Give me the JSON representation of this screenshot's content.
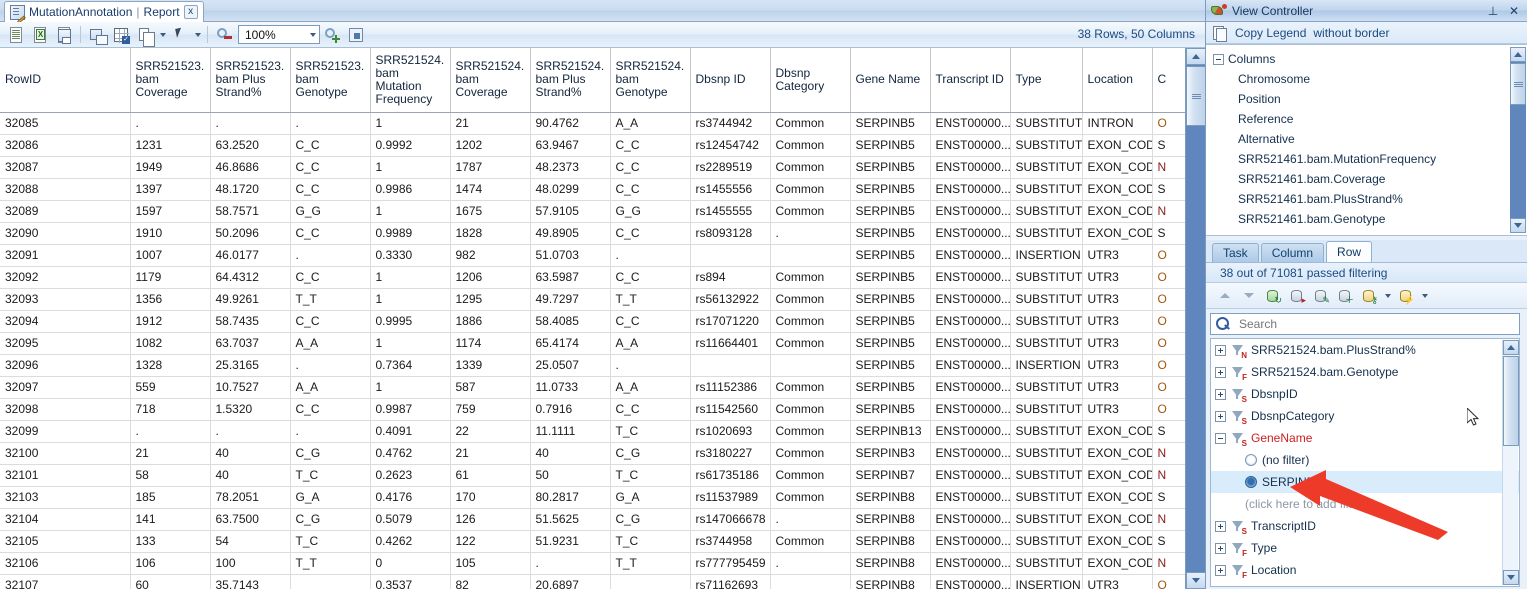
{
  "tab": {
    "title": "MutationAnnotation",
    "separator": "|",
    "subtitle": "Report",
    "close": "x",
    "icon": "report-document-icon"
  },
  "toolbar": {
    "buttons": [
      {
        "name": "export-text-icon",
        "label": ""
      },
      {
        "name": "export-excel-icon",
        "label": ""
      },
      {
        "name": "save-icon",
        "label": ""
      },
      {
        "name": "new-window-icon",
        "label": ""
      },
      {
        "name": "select-grid-icon",
        "label": ""
      },
      {
        "name": "copy-icon",
        "label": ""
      },
      {
        "name": "pointer-icon",
        "label": ""
      },
      {
        "name": "zoom-out-icon",
        "label": ""
      },
      {
        "name": "zoom-in-icon",
        "label": ""
      },
      {
        "name": "fit-to-window-icon",
        "label": ""
      }
    ],
    "zoom_value": "100%",
    "rows_columns": "38 Rows, 50 Columns"
  },
  "grid": {
    "columns": [
      "RowID",
      "SRR521523.bam Coverage",
      "SRR521523.bam Plus Strand%",
      "SRR521523.bam Genotype",
      "SRR521524.bam Mutation Frequency",
      "SRR521524.bam Coverage",
      "SRR521524.bam Plus Strand%",
      "SRR521524.bam Genotype",
      "Dbsnp ID",
      "Dbsnp Category",
      "Gene Name",
      "Transcript ID",
      "Type",
      "Location",
      "C"
    ],
    "rows": [
      [
        "32085",
        ".",
        ".",
        ".",
        "1",
        "21",
        "90.4762",
        "A_A",
        "rs3744942",
        "Common",
        "SERPINB5",
        "ENST00000...",
        "SUBSTITUT...",
        "INTRON",
        "O"
      ],
      [
        "32086",
        "1231",
        "63.2520",
        "C_C",
        "0.9992",
        "1202",
        "63.9467",
        "C_C",
        "rs12454742",
        "Common",
        "SERPINB5",
        "ENST00000...",
        "SUBSTITUT...",
        "EXON_COD...",
        "S"
      ],
      [
        "32087",
        "1949",
        "46.8686",
        "C_C",
        "1",
        "1787",
        "48.2373",
        "C_C",
        "rs2289519",
        "Common",
        "SERPINB5",
        "ENST00000...",
        "SUBSTITUT...",
        "EXON_COD...",
        "N"
      ],
      [
        "32088",
        "1397",
        "48.1720",
        "C_C",
        "0.9986",
        "1474",
        "48.0299",
        "C_C",
        "rs1455556",
        "Common",
        "SERPINB5",
        "ENST00000...",
        "SUBSTITUT...",
        "EXON_COD...",
        "S"
      ],
      [
        "32089",
        "1597",
        "58.7571",
        "G_G",
        "1",
        "1675",
        "57.9105",
        "G_G",
        "rs1455555",
        "Common",
        "SERPINB5",
        "ENST00000...",
        "SUBSTITUT...",
        "EXON_COD...",
        "N"
      ],
      [
        "32090",
        "1910",
        "50.2096",
        "C_C",
        "0.9989",
        "1828",
        "49.8905",
        "C_C",
        "rs8093128",
        ".",
        "SERPINB5",
        "ENST00000...",
        "SUBSTITUT...",
        "EXON_COD...",
        "S"
      ],
      [
        "32091",
        "1007",
        "46.0177",
        ".",
        "0.3330",
        "982",
        "51.0703",
        ".",
        "",
        "",
        "SERPINB5",
        "ENST00000...",
        "INSERTION",
        "UTR3",
        "O"
      ],
      [
        "32092",
        "1179",
        "64.4312",
        "C_C",
        "1",
        "1206",
        "63.5987",
        "C_C",
        "rs894",
        "Common",
        "SERPINB5",
        "ENST00000...",
        "SUBSTITUT...",
        "UTR3",
        "O"
      ],
      [
        "32093",
        "1356",
        "49.9261",
        "T_T",
        "1",
        "1295",
        "49.7297",
        "T_T",
        "rs56132922",
        "Common",
        "SERPINB5",
        "ENST00000...",
        "SUBSTITUT...",
        "UTR3",
        "O"
      ],
      [
        "32094",
        "1912",
        "58.7435",
        "C_C",
        "0.9995",
        "1886",
        "58.4085",
        "C_C",
        "rs17071220",
        "Common",
        "SERPINB5",
        "ENST00000...",
        "SUBSTITUT...",
        "UTR3",
        "O"
      ],
      [
        "32095",
        "1082",
        "63.7037",
        "A_A",
        "1",
        "1174",
        "65.4174",
        "A_A",
        "rs11664401",
        "Common",
        "SERPINB5",
        "ENST00000...",
        "SUBSTITUT...",
        "UTR3",
        "O"
      ],
      [
        "32096",
        "1328",
        "25.3165",
        ".",
        "0.7364",
        "1339",
        "25.0507",
        ".",
        "",
        "",
        "SERPINB5",
        "ENST00000...",
        "INSERTION",
        "UTR3",
        "O"
      ],
      [
        "32097",
        "559",
        "10.7527",
        "A_A",
        "1",
        "587",
        "11.0733",
        "A_A",
        "rs11152386",
        "Common",
        "SERPINB5",
        "ENST00000...",
        "SUBSTITUT...",
        "UTR3",
        "O"
      ],
      [
        "32098",
        "718",
        "1.5320",
        "C_C",
        "0.9987",
        "759",
        "0.7916",
        "C_C",
        "rs11542560",
        "Common",
        "SERPINB5",
        "ENST00000...",
        "SUBSTITUT...",
        "UTR3",
        "O"
      ],
      [
        "32099",
        ".",
        ".",
        ".",
        "0.4091",
        "22",
        "11.1111",
        "T_C",
        "rs1020693",
        "Common",
        "SERPINB13",
        "ENST00000...",
        "SUBSTITUT...",
        "EXON_COD...",
        "S"
      ],
      [
        "32100",
        "21",
        "40",
        "C_G",
        "0.4762",
        "21",
        "40",
        "C_G",
        "rs3180227",
        "Common",
        "SERPINB3",
        "ENST00000...",
        "SUBSTITUT...",
        "EXON_COD...",
        "N"
      ],
      [
        "32101",
        "58",
        "40",
        "T_C",
        "0.2623",
        "61",
        "50",
        "T_C",
        "rs61735186",
        "Common",
        "SERPINB7",
        "ENST00000...",
        "SUBSTITUT...",
        "EXON_COD...",
        "N"
      ],
      [
        "32103",
        "185",
        "78.2051",
        "G_A",
        "0.4176",
        "170",
        "80.2817",
        "G_A",
        "rs11537989",
        "Common",
        "SERPINB8",
        "ENST00000...",
        "SUBSTITUT...",
        "EXON_COD...",
        "S"
      ],
      [
        "32104",
        "141",
        "63.7500",
        "C_G",
        "0.5079",
        "126",
        "51.5625",
        "C_G",
        "rs147066678",
        ".",
        "SERPINB8",
        "ENST00000...",
        "SUBSTITUT...",
        "EXON_COD...",
        "N"
      ],
      [
        "32105",
        "133",
        "54",
        "T_C",
        "0.4262",
        "122",
        "51.9231",
        "T_C",
        "rs3744958",
        "Common",
        "SERPINB8",
        "ENST00000...",
        "SUBSTITUT...",
        "EXON_COD...",
        "S"
      ],
      [
        "32106",
        "106",
        "100",
        "T_T",
        "0",
        "105",
        ".",
        "T_T",
        "rs777795459",
        ".",
        "SERPINB8",
        "ENST00000...",
        "SUBSTITUT...",
        "EXON_COD...",
        "N"
      ],
      [
        "32107",
        "60",
        "35.7143",
        "",
        "0.3537",
        "82",
        "20.6897",
        "",
        "rs71162693",
        "",
        "SERPINB8",
        "ENST00000...",
        "INSERTION",
        "UTR3",
        "O"
      ]
    ]
  },
  "view_controller": {
    "title": "View Controller",
    "title_icon": "view-controller-icon",
    "pin_glyph": "⊥",
    "close_glyph": "✕",
    "legend": {
      "icon": "copy-legend-icon",
      "label": "Copy Legend",
      "suffix": "without border"
    },
    "columns_tree": {
      "root": "Columns",
      "items": [
        "Chromosome",
        "Position",
        "Reference",
        "Alternative",
        "SRR521461.bam.MutationFrequency",
        "SRR521461.bam.Coverage",
        "SRR521461.bam.PlusStrand%",
        "SRR521461.bam.Genotype"
      ]
    },
    "tabs": [
      {
        "label": "Task",
        "active": false
      },
      {
        "label": "Column",
        "active": false
      },
      {
        "label": "Row",
        "active": true
      }
    ],
    "status": "38 out of 71081 passed filtering",
    "toolbar2": [
      {
        "name": "move-up-icon"
      },
      {
        "name": "move-down-icon"
      },
      {
        "name": "refresh-database-icon"
      },
      {
        "name": "import-database-icon"
      },
      {
        "name": "edit-database-icon"
      },
      {
        "name": "add-database-icon"
      },
      {
        "name": "key-database-icon"
      },
      {
        "name": "key-database-dropdown-icon"
      },
      {
        "name": "lightning-database-icon"
      },
      {
        "name": "lightning-database-dropdown-icon"
      }
    ],
    "search": {
      "icon": "search-icon",
      "placeholder": "Search",
      "value": ""
    },
    "filter_list": [
      {
        "label": "SRR521524.bam.PlusStrand%",
        "tag": "N",
        "expander": "plus",
        "level": 0,
        "highlight": false
      },
      {
        "label": "SRR521524.bam.Genotype",
        "tag": "F",
        "expander": "plus",
        "level": 0,
        "highlight": false
      },
      {
        "label": "DbsnpID",
        "tag": "S",
        "expander": "plus",
        "level": 0,
        "highlight": false
      },
      {
        "label": "DbsnpCategory",
        "tag": "S",
        "expander": "plus",
        "level": 0,
        "highlight": false
      },
      {
        "label": "GeneName",
        "tag": "S",
        "expander": "minus",
        "level": 0,
        "highlight": true
      },
      {
        "label": "(no filter)",
        "tag": "",
        "expander": "none",
        "level": 1,
        "highlight": false,
        "radio": "unchecked"
      },
      {
        "label": "SERPINB",
        "tag": "",
        "expander": "none",
        "level": 1,
        "highlight": false,
        "radio": "checked",
        "selected": true
      },
      {
        "label": "(click here to add filter)",
        "tag": "",
        "expander": "none",
        "level": 2,
        "highlight": false
      },
      {
        "label": "TranscriptID",
        "tag": "S",
        "expander": "plus",
        "level": 0,
        "highlight": false
      },
      {
        "label": "Type",
        "tag": "F",
        "expander": "plus",
        "level": 0,
        "highlight": false
      },
      {
        "label": "Location",
        "tag": "F",
        "expander": "plus",
        "level": 0,
        "highlight": false
      }
    ]
  },
  "annotation": {
    "arrow_color": "#ee3b29",
    "name": "red-callout-arrow"
  }
}
